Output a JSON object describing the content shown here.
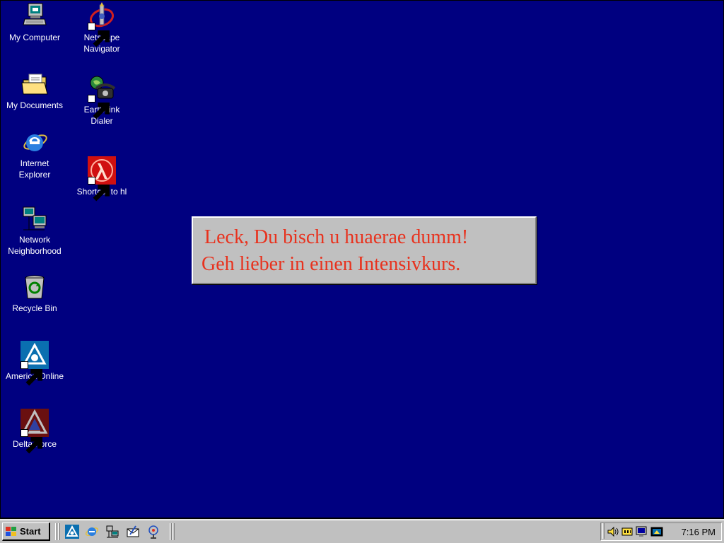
{
  "desktop": {
    "background_color": "#000080",
    "icons": [
      {
        "label": "My Computer",
        "icon": "my-computer-icon"
      },
      {
        "label": "My Documents",
        "icon": "my-documents-icon"
      },
      {
        "label": "Internet\nExplorer",
        "icon": "internet-explorer-icon"
      },
      {
        "label": "Network\nNeighborhood",
        "icon": "network-neighborhood-icon"
      },
      {
        "label": "Recycle Bin",
        "icon": "recycle-bin-icon"
      },
      {
        "label": "America Online",
        "icon": "america-online-icon"
      },
      {
        "label": "Delta Force",
        "icon": "delta-force-icon"
      },
      {
        "label": "Netscape\nNavigator",
        "icon": "netscape-navigator-icon"
      },
      {
        "label": "EarthLink\nDialer",
        "icon": "earthlink-dialer-icon"
      },
      {
        "label": "Shortcut to hl",
        "icon": "half-life-icon"
      }
    ]
  },
  "message_box": {
    "line1": "Leck, Du bisch u huaerae dumm!",
    "line2": "Geh lieber in einen Intensivkurs.",
    "text_color": "#e8321e"
  },
  "taskbar": {
    "start_label": "Start",
    "quick_launch": [
      "america-online-icon",
      "internet-explorer-icon",
      "network-icon",
      "outlook-express-icon",
      "channels-icon"
    ],
    "tray_icons": [
      "volume-icon",
      "modem-icon",
      "monitor-icon",
      "display-icon"
    ],
    "clock": "7:16 PM"
  }
}
